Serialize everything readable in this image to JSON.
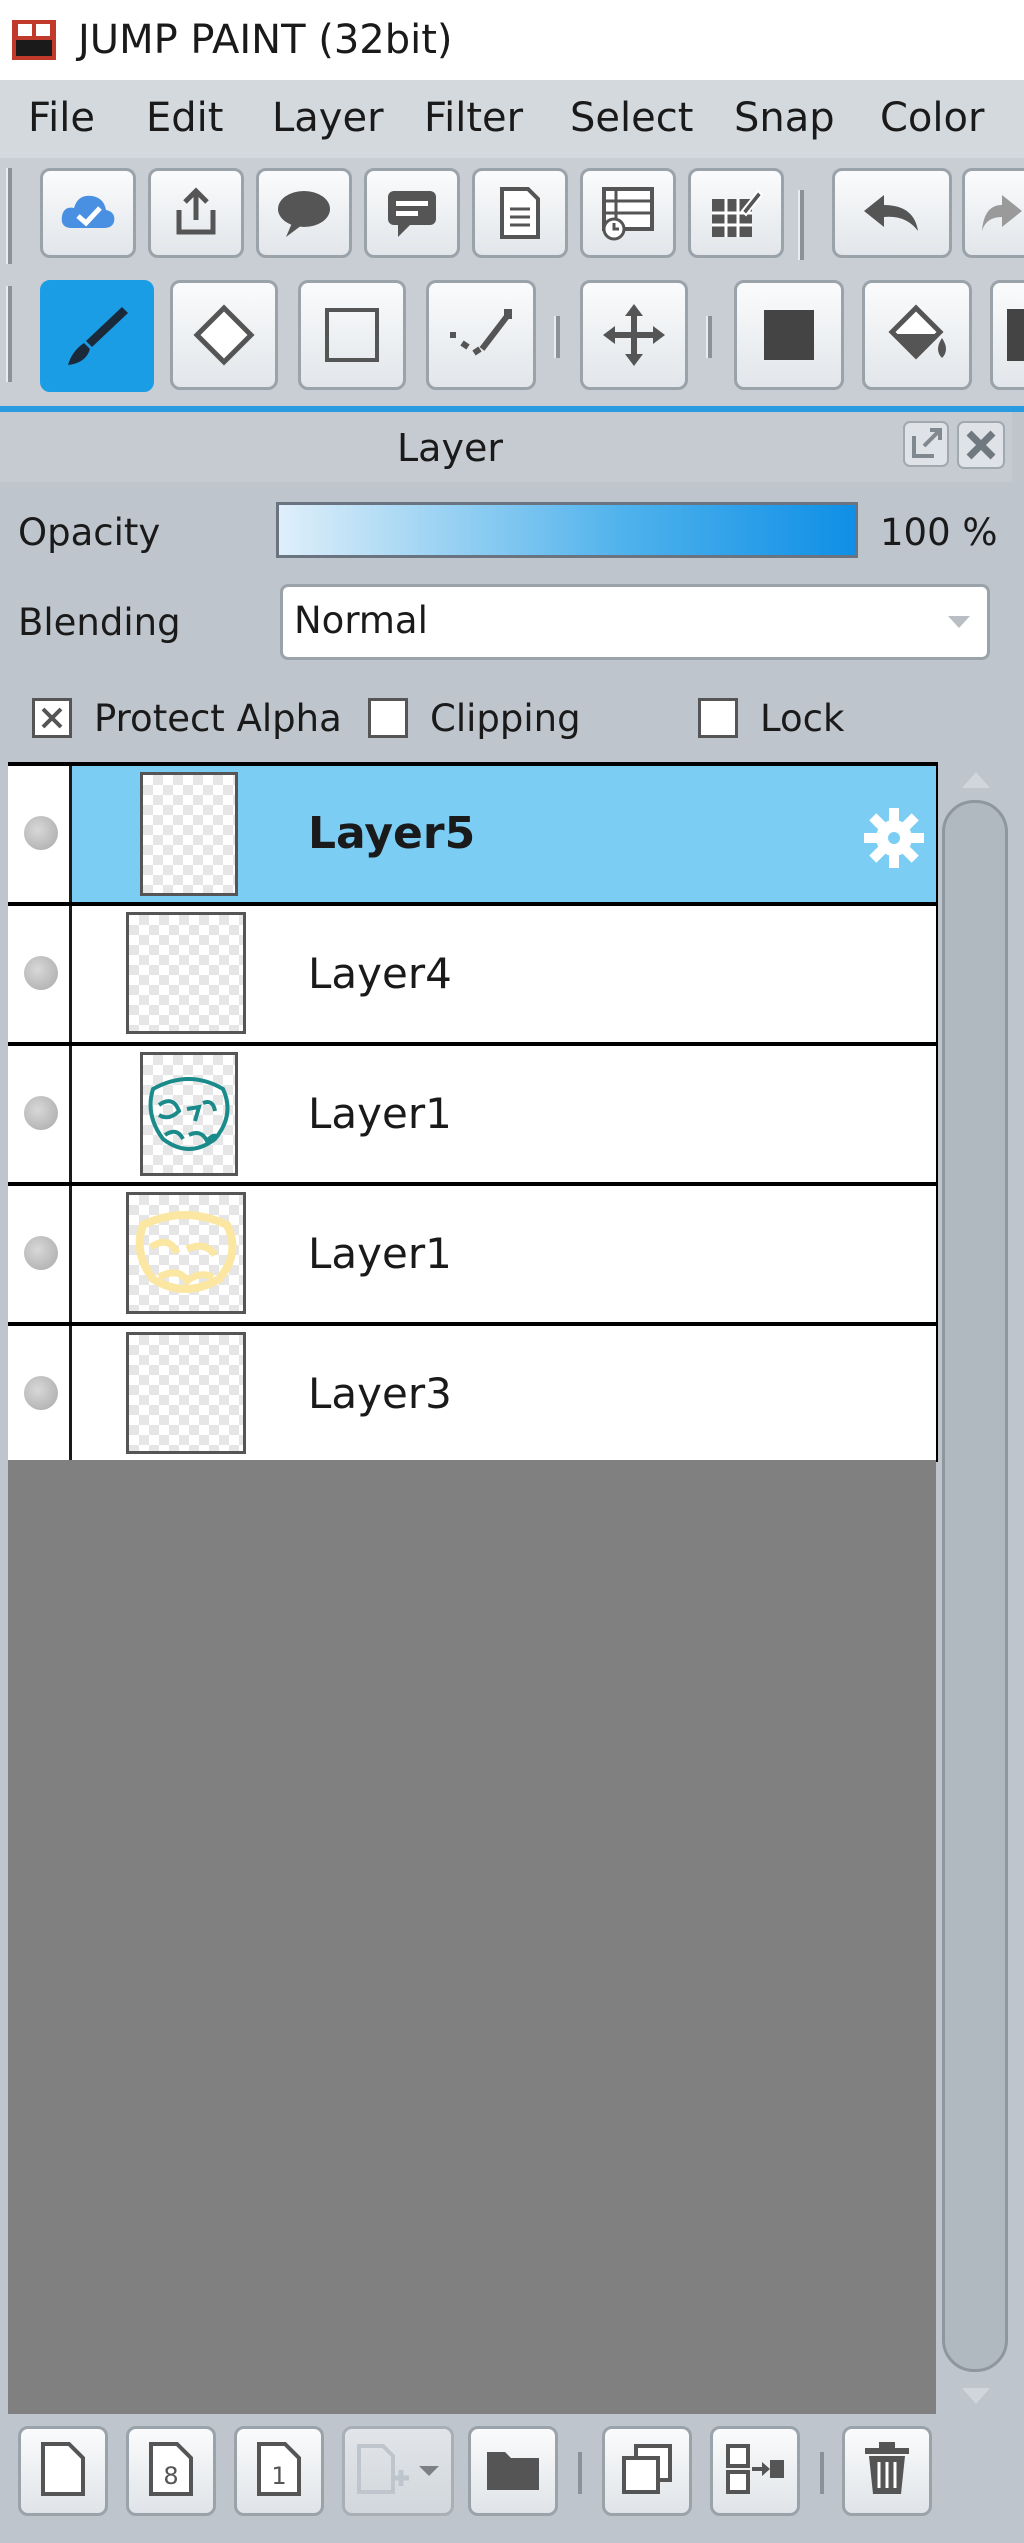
{
  "window": {
    "title": "JUMP PAINT (32bit)"
  },
  "menu": [
    "File",
    "Edit",
    "Layer",
    "Filter",
    "Select",
    "Snap",
    "Color"
  ],
  "toolbar_row1": [
    "cloud-sync-icon",
    "share-icon",
    "speech-bubble-icon",
    "comment-icon",
    "page-icon",
    "history-icon",
    "grid-settings-icon",
    "undo-icon",
    "redo-icon"
  ],
  "toolbar_row2": [
    "brush-icon",
    "eraser-icon",
    "rectangle-select-icon",
    "lasso-line-icon",
    "move-icon",
    "fill-square-icon",
    "paint-bucket-icon",
    "more-tool-icon"
  ],
  "panel": {
    "title": "Layer",
    "opacity_label": "Opacity",
    "opacity_value": "100 %",
    "opacity_fraction": 1.0,
    "blending_label": "Blending",
    "blending_value": "Normal",
    "protect_alpha_label": "Protect Alpha",
    "protect_alpha_checked": true,
    "clipping_label": "Clipping",
    "clipping_checked": false,
    "lock_label": "Lock",
    "lock_checked": false
  },
  "layers": [
    {
      "name": "Layer5",
      "selected": true
    },
    {
      "name": "Layer4",
      "selected": false
    },
    {
      "name": "Layer1",
      "selected": false
    },
    {
      "name": "Layer1",
      "selected": false
    },
    {
      "name": "Layer3",
      "selected": false
    }
  ],
  "bottom_buttons": [
    "new-layer-icon",
    "new-8bit-layer-icon",
    "new-1bit-layer-icon",
    "add-dropdown-icon",
    "folder-icon",
    "duplicate-icon",
    "merge-down-icon",
    "delete-icon"
  ],
  "colors": {
    "accent": "#1b9de6",
    "selected_row": "#7ccdf4",
    "empty_area": "#808080"
  }
}
